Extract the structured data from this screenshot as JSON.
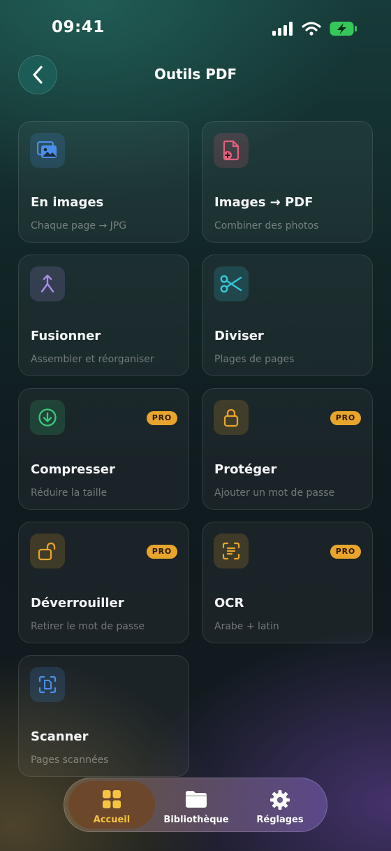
{
  "status_bar": {
    "time": "09:41"
  },
  "header": {
    "title": "Outils PDF"
  },
  "tools": [
    {
      "title": "En images",
      "subtitle": "Chaque page → JPG",
      "icon": "images-icon",
      "pro": false
    },
    {
      "title": "Images → PDF",
      "subtitle": "Combiner des photos",
      "icon": "file-add-icon",
      "pro": false
    },
    {
      "title": "Fusionner",
      "subtitle": "Assembler et réorganiser",
      "icon": "merge-icon",
      "pro": false
    },
    {
      "title": "Diviser",
      "subtitle": "Plages de pages",
      "icon": "scissors-icon",
      "pro": false
    },
    {
      "title": "Compresser",
      "subtitle": "Réduire la taille",
      "icon": "download-circle-icon",
      "pro": true,
      "badge": "PRO"
    },
    {
      "title": "Protéger",
      "subtitle": "Ajouter un mot de passe",
      "icon": "lock-icon",
      "pro": true,
      "badge": "PRO"
    },
    {
      "title": "Déverrouiller",
      "subtitle": "Retirer le mot de passe",
      "icon": "unlock-icon",
      "pro": true,
      "badge": "PRO"
    },
    {
      "title": "OCR",
      "subtitle": "Arabe + latin",
      "icon": "scan-text-icon",
      "pro": true,
      "badge": "PRO"
    },
    {
      "title": "Scanner",
      "subtitle": "Pages scannées",
      "icon": "scan-document-icon",
      "pro": false
    }
  ],
  "tab_bar": {
    "tabs": [
      {
        "label": "Accueil",
        "icon": "grid-icon",
        "active": true
      },
      {
        "label": "Bibliothèque",
        "icon": "folder-icon",
        "active": false
      },
      {
        "label": "Réglages",
        "icon": "gear-icon",
        "active": false
      }
    ]
  },
  "colors": {
    "accent_pro": "#e8a52c",
    "active_tab": "#f5c542",
    "icon_blue": "#4a8fe7",
    "icon_pink": "#e2607d",
    "icon_purple": "#a98ee8",
    "icon_cyan": "#38c6d9",
    "icon_green": "#3ec77c",
    "icon_amber": "#e8a52c"
  }
}
